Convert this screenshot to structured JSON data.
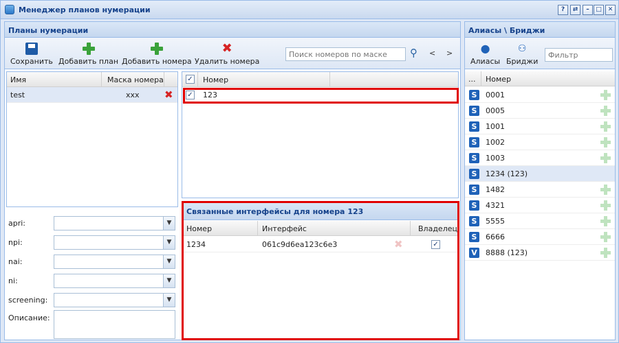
{
  "window": {
    "title": "Менеджер планов нумерации",
    "controls": [
      "?",
      "⇄",
      "–",
      "□",
      "✕"
    ]
  },
  "plans_panel": {
    "title": "Планы нумерации",
    "toolbar": {
      "save": "Сохранить",
      "add_plan": "Добавить план",
      "add_number": "Добавить номера",
      "delete_number": "Удалить номера",
      "search_placeholder": "Поиск номеров по маске",
      "prev": "<",
      "next": ">"
    },
    "plans_grid": {
      "col_name": "Имя",
      "col_mask": "Маска номера",
      "rows": [
        {
          "name": "test",
          "mask": "xxx"
        }
      ]
    },
    "numbers_grid": {
      "col_number": "Номер",
      "rows": [
        {
          "number": "123",
          "checked": true
        }
      ]
    },
    "form": {
      "apri": "apri:",
      "npi": "npi:",
      "nai": "nai:",
      "ni": "ni:",
      "screening": "screening:",
      "description": "Описание:"
    },
    "linked": {
      "title": "Связанные интерфейсы для номера 123",
      "col_number": "Номер",
      "col_interface": "Интерфейс",
      "col_owner": "Владелец",
      "rows": [
        {
          "number": "1234",
          "interface": "061c9d6ea123c6e3",
          "owner": true
        }
      ]
    }
  },
  "aliases_panel": {
    "title": "Алиасы \\ Бриджи",
    "toolbar": {
      "aliases": "Алиасы",
      "bridges": "Бриджи",
      "filter_placeholder": "Фильтр"
    },
    "grid": {
      "col_dots": "...",
      "col_number": "Номер",
      "rows": [
        {
          "badge": "S",
          "number": "0001"
        },
        {
          "badge": "S",
          "number": "0005"
        },
        {
          "badge": "S",
          "number": "1001"
        },
        {
          "badge": "S",
          "number": "1002"
        },
        {
          "badge": "S",
          "number": "1003"
        },
        {
          "badge": "S",
          "number": "1234 (123)"
        },
        {
          "badge": "S",
          "number": "1482"
        },
        {
          "badge": "S",
          "number": "4321"
        },
        {
          "badge": "S",
          "number": "5555"
        },
        {
          "badge": "S",
          "number": "6666"
        },
        {
          "badge": "V",
          "number": "8888 (123)"
        }
      ]
    }
  },
  "colors": {
    "highlight": "#e00000",
    "header_text": "#15428b"
  }
}
